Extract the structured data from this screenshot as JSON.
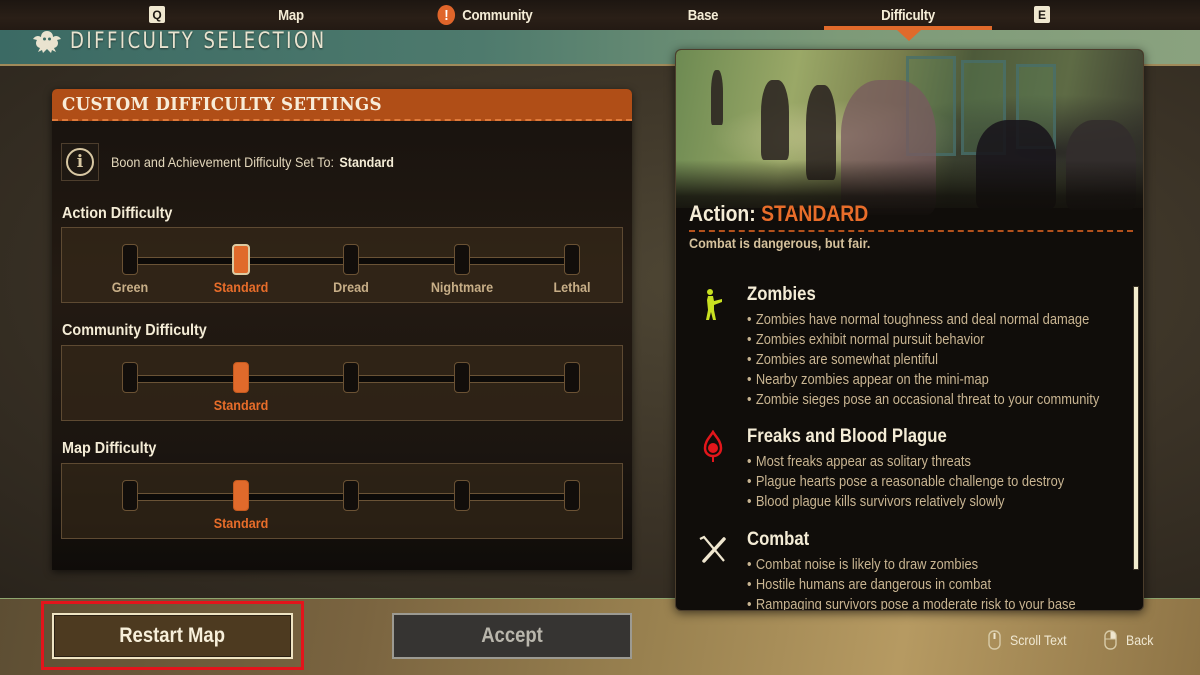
{
  "nav": {
    "left_key": "Q",
    "right_key": "E",
    "tabs": [
      {
        "label": "Map",
        "alert": false,
        "active": false
      },
      {
        "label": "Community",
        "alert": true,
        "alert_symbol": "!",
        "active": false
      },
      {
        "label": "Base",
        "alert": false,
        "active": false
      },
      {
        "label": "Difficulty",
        "alert": false,
        "active": true
      }
    ]
  },
  "page": {
    "title": "DIFFICULTY SELECTION",
    "crest_icon": "crest-icon"
  },
  "custom_settings": {
    "header": "CUSTOM DIFFICULTY SETTINGS",
    "info": {
      "icon": "info-icon",
      "icon_glyph": "i",
      "text": "Boon and Achievement Difficulty Set To:",
      "value": "Standard"
    },
    "levels": [
      "Green",
      "Standard",
      "Dread",
      "Nightmare",
      "Lethal"
    ],
    "sliders": [
      {
        "label": "Action Difficulty",
        "selected_index": 1,
        "selected_label": "Standard",
        "show_all_labels": true,
        "focused": true
      },
      {
        "label": "Community Difficulty",
        "selected_index": 1,
        "selected_label": "Standard",
        "show_all_labels": false,
        "focused": false
      },
      {
        "label": "Map Difficulty",
        "selected_index": 1,
        "selected_label": "Standard",
        "show_all_labels": false,
        "focused": false
      }
    ]
  },
  "details": {
    "title_prefix": "Action:",
    "title_value": "STANDARD",
    "subtitle": "Combat is dangerous, but fair.",
    "sections": [
      {
        "heading": "Zombies",
        "icon": "zombie-icon",
        "icon_color": "#c8e021",
        "bullets": [
          "Zombies have normal toughness and deal normal damage",
          "Zombies exhibit normal pursuit behavior",
          "Zombies are somewhat plentiful",
          "Nearby zombies appear on the mini-map",
          "Zombie sieges pose an occasional threat to your community"
        ]
      },
      {
        "heading": "Freaks and Blood Plague",
        "icon": "blood-plague-skull-icon",
        "icon_color": "#e3161b",
        "bullets": [
          "Most freaks appear as solitary threats",
          "Plague hearts pose a reasonable challenge to destroy",
          "Blood plague kills survivors relatively slowly"
        ]
      },
      {
        "heading": "Combat",
        "icon": "crossed-weapons-icon",
        "icon_color": "#efe6cf",
        "bullets": [
          "Combat noise is likely to draw zombies",
          "Hostile humans are dangerous in combat",
          "Rampaging survivors pose a moderate risk to your base"
        ]
      }
    ]
  },
  "footer": {
    "restart_label": "Restart Map",
    "accept_label": "Accept",
    "accept_enabled": false,
    "hints": [
      {
        "icon": "mouse-scroll-icon",
        "label": "Scroll Text"
      },
      {
        "icon": "mouse-right-click-icon",
        "label": "Back"
      }
    ]
  },
  "colors": {
    "accent": "#e06a2b",
    "header_bar": "#b04e17",
    "highlight_outline": "#e3141b"
  }
}
